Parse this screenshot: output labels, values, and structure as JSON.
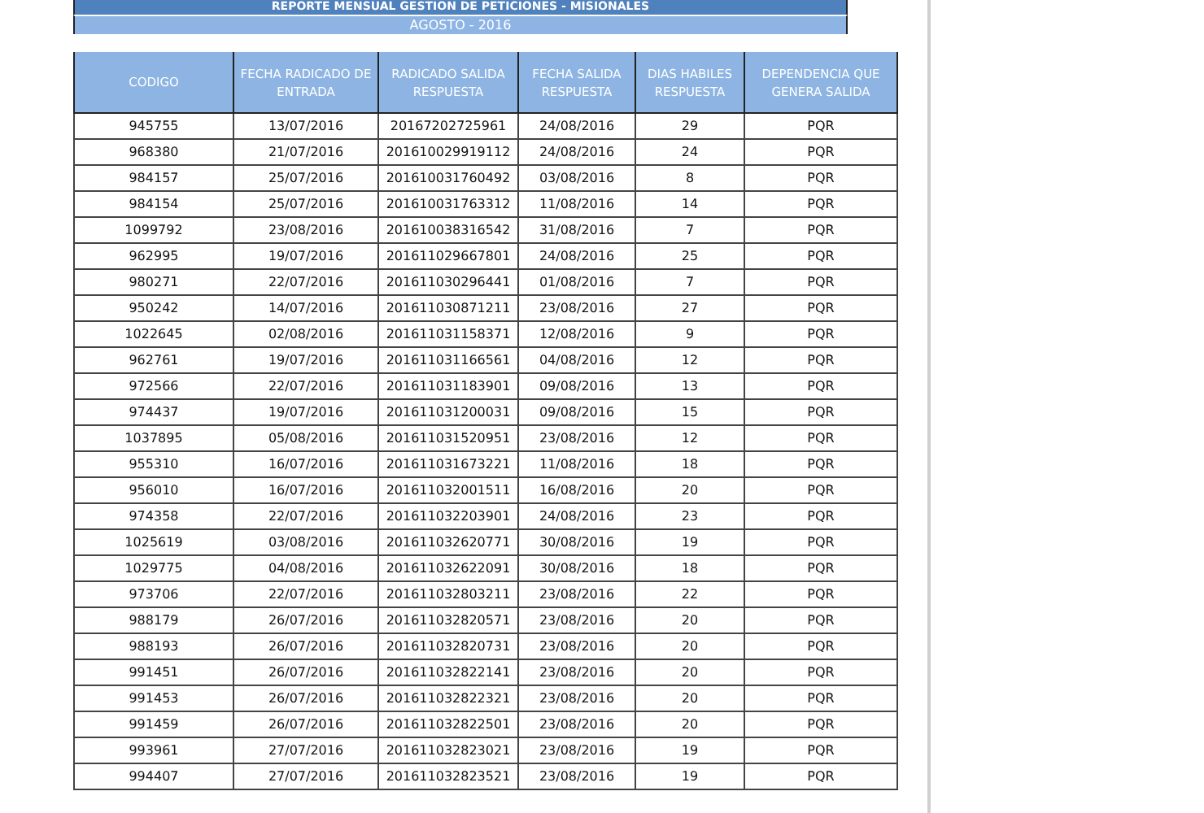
{
  "report": {
    "title": "REPORTE MENSUAL GESTION DE PETICIONES - MISIONALES",
    "period": "AGOSTO - 2016"
  },
  "table": {
    "columns": [
      "CODIGO",
      "FECHA RADICADO DE ENTRADA",
      "RADICADO SALIDA RESPUESTA",
      "FECHA SALIDA RESPUESTA",
      "DIAS HABILES RESPUESTA",
      "DEPENDENCIA QUE GENERA SALIDA"
    ],
    "rows": [
      [
        "945755",
        "13/07/2016",
        "20167202725961",
        "24/08/2016",
        "29",
        "PQR"
      ],
      [
        "968380",
        "21/07/2016",
        "201610029919112",
        "24/08/2016",
        "24",
        "PQR"
      ],
      [
        "984157",
        "25/07/2016",
        "201610031760492",
        "03/08/2016",
        "8",
        "PQR"
      ],
      [
        "984154",
        "25/07/2016",
        "201610031763312",
        "11/08/2016",
        "14",
        "PQR"
      ],
      [
        "1099792",
        "23/08/2016",
        "201610038316542",
        "31/08/2016",
        "7",
        "PQR"
      ],
      [
        "962995",
        "19/07/2016",
        "201611029667801",
        "24/08/2016",
        "25",
        "PQR"
      ],
      [
        "980271",
        "22/07/2016",
        "201611030296441",
        "01/08/2016",
        "7",
        "PQR"
      ],
      [
        "950242",
        "14/07/2016",
        "201611030871211",
        "23/08/2016",
        "27",
        "PQR"
      ],
      [
        "1022645",
        "02/08/2016",
        "201611031158371",
        "12/08/2016",
        "9",
        "PQR"
      ],
      [
        "962761",
        "19/07/2016",
        "201611031166561",
        "04/08/2016",
        "12",
        "PQR"
      ],
      [
        "972566",
        "22/07/2016",
        "201611031183901",
        "09/08/2016",
        "13",
        "PQR"
      ],
      [
        "974437",
        "19/07/2016",
        "201611031200031",
        "09/08/2016",
        "15",
        "PQR"
      ],
      [
        "1037895",
        "05/08/2016",
        "201611031520951",
        "23/08/2016",
        "12",
        "PQR"
      ],
      [
        "955310",
        "16/07/2016",
        "201611031673221",
        "11/08/2016",
        "18",
        "PQR"
      ],
      [
        "956010",
        "16/07/2016",
        "201611032001511",
        "16/08/2016",
        "20",
        "PQR"
      ],
      [
        "974358",
        "22/07/2016",
        "201611032203901",
        "24/08/2016",
        "23",
        "PQR"
      ],
      [
        "1025619",
        "03/08/2016",
        "201611032620771",
        "30/08/2016",
        "19",
        "PQR"
      ],
      [
        "1029775",
        "04/08/2016",
        "201611032622091",
        "30/08/2016",
        "18",
        "PQR"
      ],
      [
        "973706",
        "22/07/2016",
        "201611032803211",
        "23/08/2016",
        "22",
        "PQR"
      ],
      [
        "988179",
        "26/07/2016",
        "201611032820571",
        "23/08/2016",
        "20",
        "PQR"
      ],
      [
        "988193",
        "26/07/2016",
        "201611032820731",
        "23/08/2016",
        "20",
        "PQR"
      ],
      [
        "991451",
        "26/07/2016",
        "201611032822141",
        "23/08/2016",
        "20",
        "PQR"
      ],
      [
        "991453",
        "26/07/2016",
        "201611032822321",
        "23/08/2016",
        "20",
        "PQR"
      ],
      [
        "991459",
        "26/07/2016",
        "201611032822501",
        "23/08/2016",
        "20",
        "PQR"
      ],
      [
        "993961",
        "27/07/2016",
        "201611032823021",
        "23/08/2016",
        "19",
        "PQR"
      ],
      [
        "994407",
        "27/07/2016",
        "201611032823521",
        "23/08/2016",
        "19",
        "PQR"
      ]
    ]
  }
}
